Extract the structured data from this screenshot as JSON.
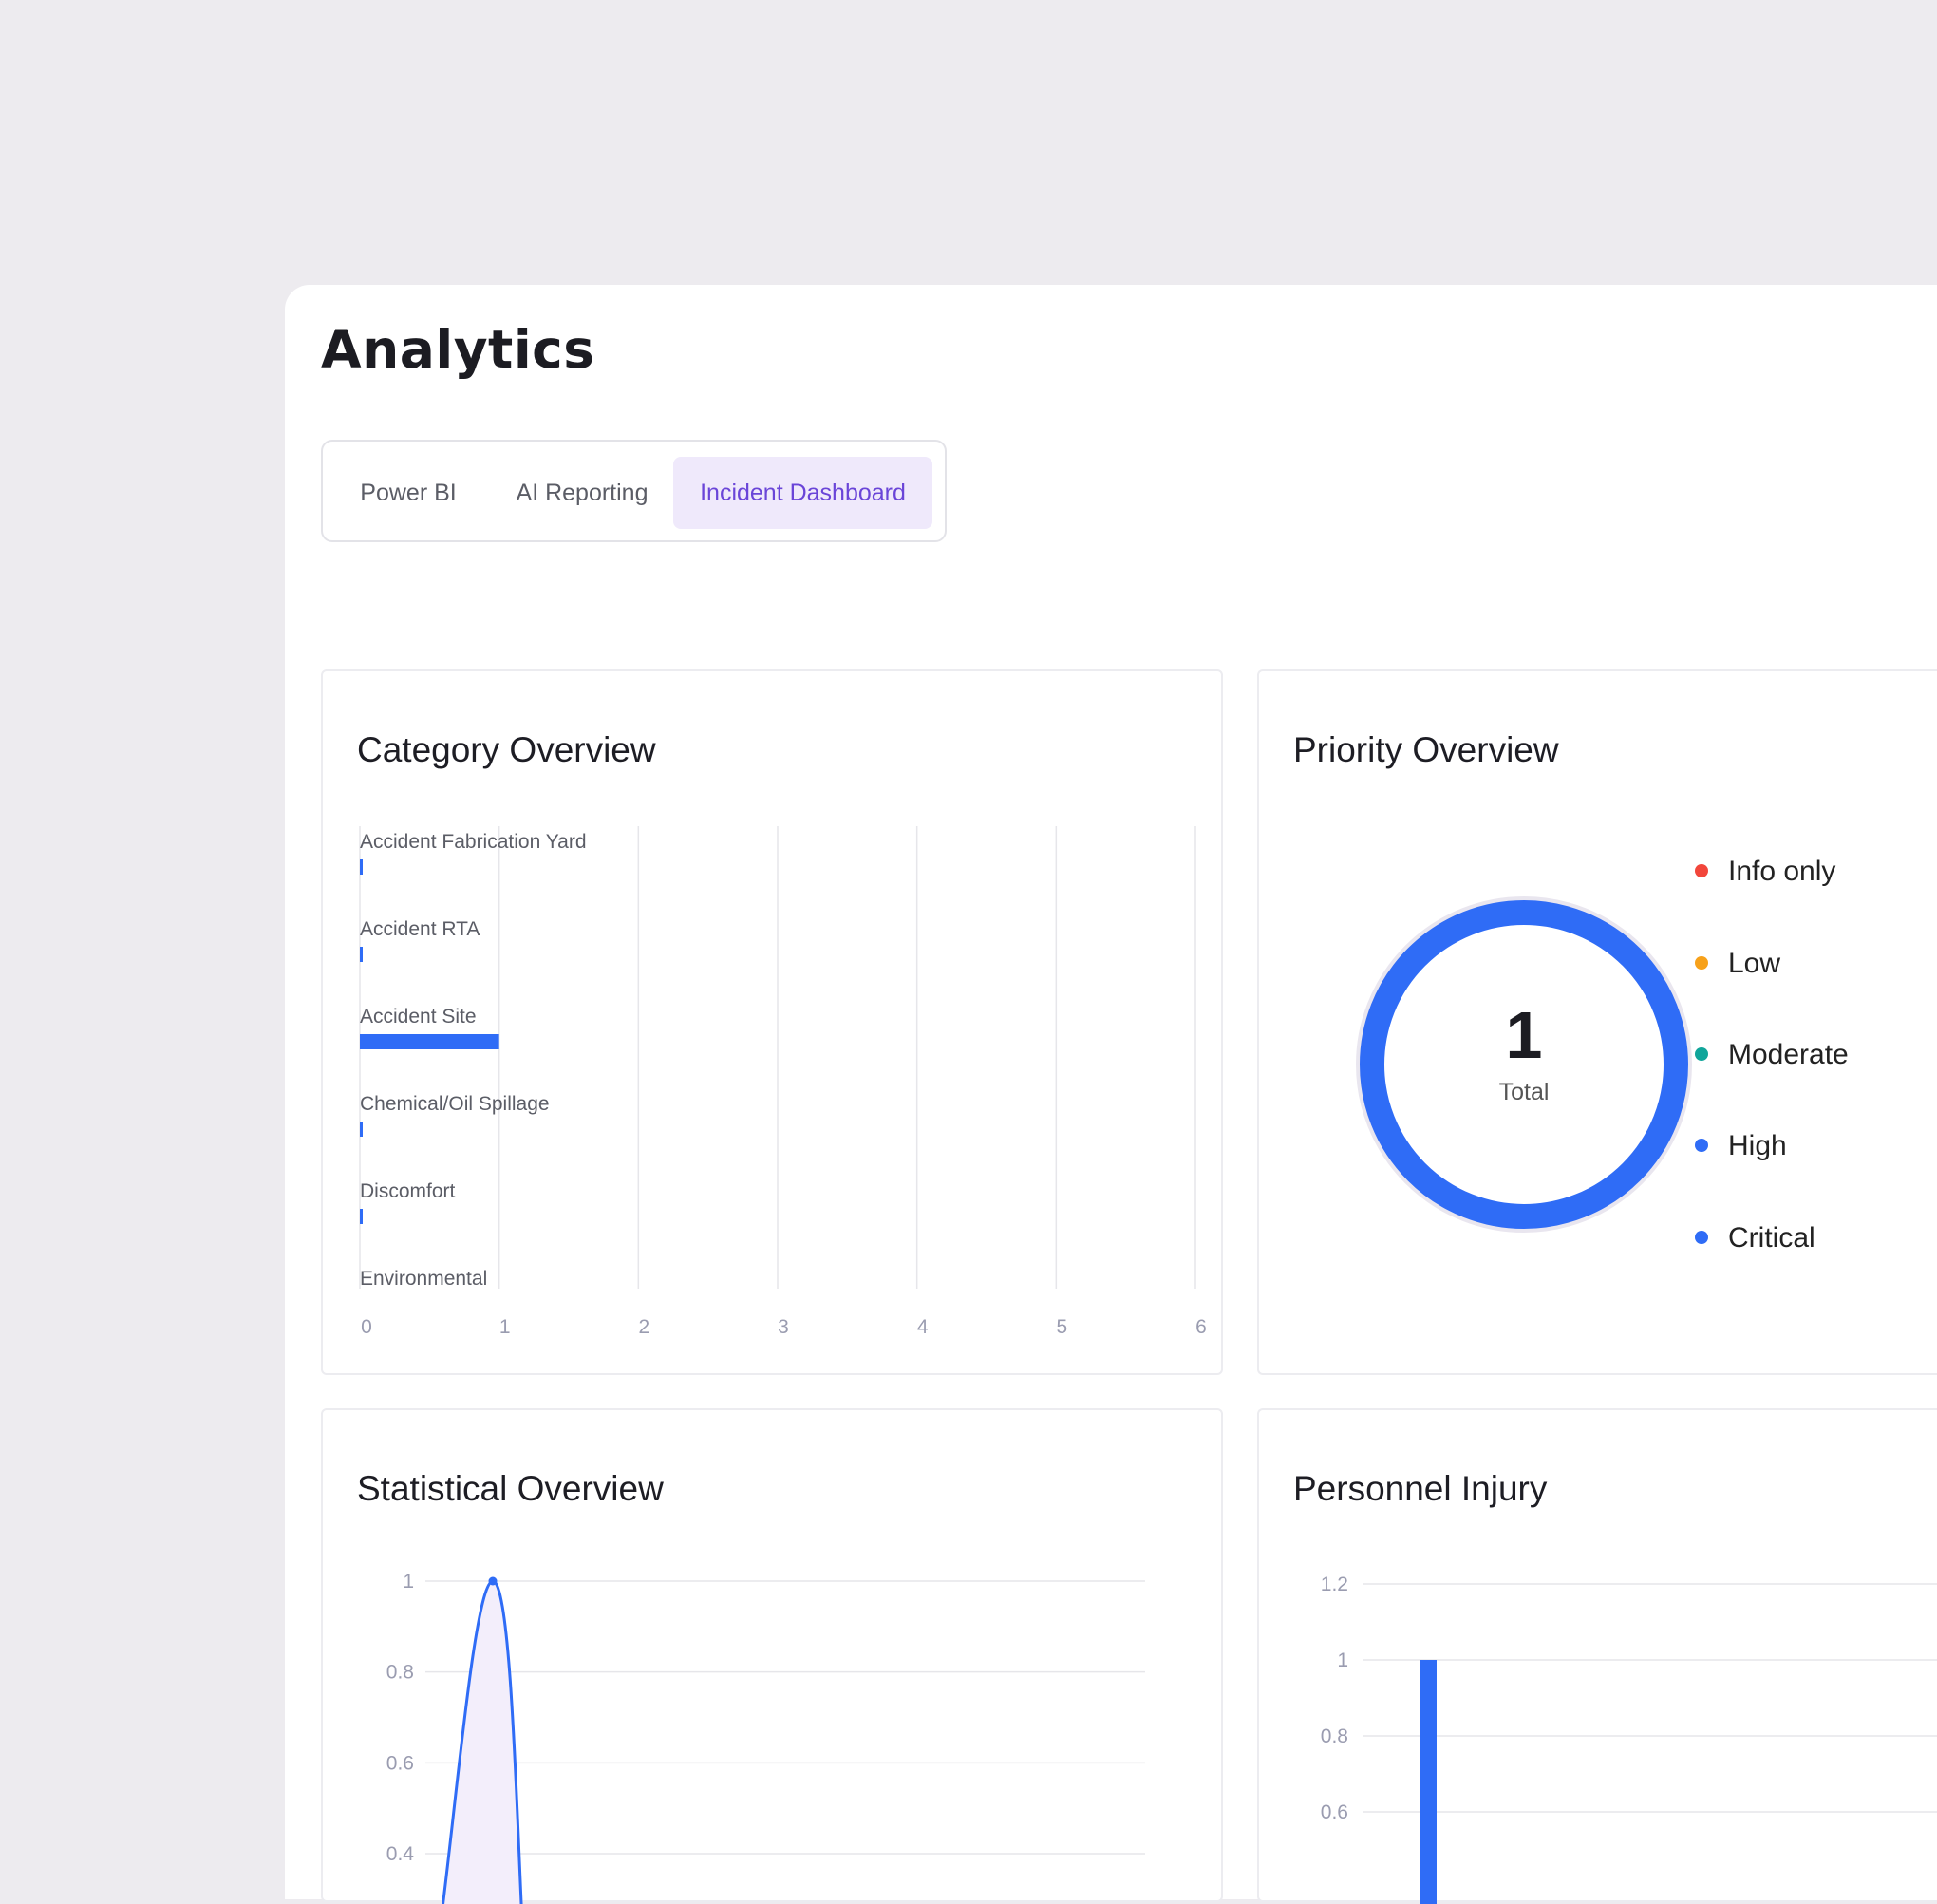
{
  "page": {
    "title": "Analytics"
  },
  "tabs": [
    {
      "label": "Power BI",
      "active": false
    },
    {
      "label": "AI Reporting",
      "active": false
    },
    {
      "label": "Incident Dashboard",
      "active": true
    }
  ],
  "colors": {
    "accent": "#2f6cf6",
    "tab_active_bg": "#efe9fb",
    "tab_active_text": "#6a45d8",
    "line_fill": "#f3eefb"
  },
  "category_overview": {
    "title": "Category Overview"
  },
  "priority_overview": {
    "title": "Priority Overview",
    "total_value": "1",
    "total_label": "Total",
    "legend": [
      {
        "label": "Info only",
        "color": "#f2463b"
      },
      {
        "label": "Low",
        "color": "#f7a11a"
      },
      {
        "label": "Moderate",
        "color": "#10a59a"
      },
      {
        "label": "High",
        "color": "#2f6cf6"
      },
      {
        "label": "Critical",
        "color": "#2f6cf6"
      }
    ]
  },
  "statistical_overview": {
    "title": "Statistical Overview"
  },
  "personnel_injury": {
    "title": "Personnel Injury"
  },
  "chart_data": [
    {
      "type": "bar",
      "orientation": "horizontal",
      "title": "Category Overview",
      "categories": [
        "Accident Fabrication Yard",
        "Accident RTA",
        "Accident Site",
        "Chemical/Oil Spillage",
        "Discomfort",
        "Environmental"
      ],
      "values": [
        0,
        0,
        1,
        0,
        0,
        0
      ],
      "xticks": [
        "0",
        "1",
        "2",
        "3",
        "4",
        "5",
        "6"
      ],
      "xlim": [
        0,
        6
      ],
      "grid": true
    },
    {
      "type": "pie",
      "title": "Priority Overview",
      "categories": [
        "Info only",
        "Low",
        "Moderate",
        "High",
        "Critical"
      ],
      "values": [
        0,
        0,
        0,
        1,
        0
      ]
    },
    {
      "type": "area",
      "title": "Statistical Overview",
      "yticks": [
        "1",
        "0.8",
        "0.6",
        "0.4"
      ],
      "ylim": [
        0.4,
        1
      ],
      "peak_value": 1,
      "grid": true
    },
    {
      "type": "bar",
      "title": "Personnel Injury",
      "yticks": [
        "1.2",
        "1",
        "0.8",
        "0.6"
      ],
      "ylim": [
        0.6,
        1.2
      ],
      "values": [
        1
      ],
      "grid": true
    }
  ]
}
